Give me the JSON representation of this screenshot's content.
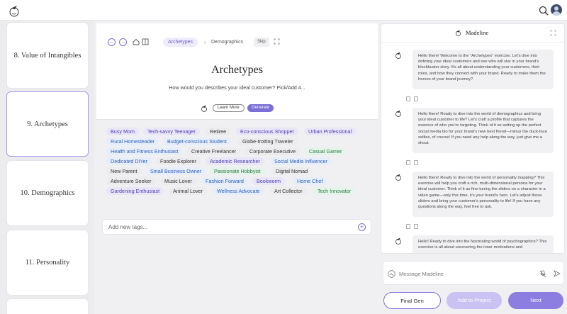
{
  "header": {
    "icons": [
      "wizard-logo-icon",
      "search-icon",
      "avatar"
    ]
  },
  "steps": [
    {
      "label": "8. Value of Intangibles"
    },
    {
      "label": "9. Archetypes"
    },
    {
      "label": "10. Demographics"
    },
    {
      "label": "11. Personality"
    }
  ],
  "breadcrumb": {
    "current": "Archetypes",
    "next": "Demographics",
    "skip": "Skip"
  },
  "main": {
    "title": "Archetypes",
    "question": "How would you describes your ideal customer? Pick/Add 4...",
    "learn_more": "Learn More",
    "generate": "Generate",
    "new_tag_placeholder": "Add new tags..."
  },
  "tags": [
    {
      "text": "Busy Mom",
      "color": "purple"
    },
    {
      "text": "Tech-savvy Teenager",
      "color": "purple"
    },
    {
      "text": "Retiree",
      "color": "gray"
    },
    {
      "text": "Eco-conscious Shopper",
      "color": "purple"
    },
    {
      "text": "Urban Professional",
      "color": "purple"
    },
    {
      "text": "Rural Homesteader",
      "color": "blue"
    },
    {
      "text": "Budget-conscious Student",
      "color": "blue"
    },
    {
      "text": "Globe-trotting Traveler",
      "color": "gray"
    },
    {
      "text": "Health and Fitness Enthusiast",
      "color": "blue"
    },
    {
      "text": "Creative Freelancer",
      "color": "gray"
    },
    {
      "text": "Corporate Executive",
      "color": "gray"
    },
    {
      "text": "Casual Gamer",
      "color": "green"
    },
    {
      "text": "Dedicated DIYer",
      "color": "blue"
    },
    {
      "text": "Foodie Explorer",
      "color": "gray"
    },
    {
      "text": "Academic Researcher",
      "color": "purple"
    },
    {
      "text": "Social Media Influencer",
      "color": "blue"
    },
    {
      "text": "New Parent",
      "color": "gray"
    },
    {
      "text": "Small Business Owner",
      "color": "blue"
    },
    {
      "text": "Passionate Hobbyist",
      "color": "green"
    },
    {
      "text": "Digital Nomad",
      "color": "gray"
    },
    {
      "text": "Adventure Seeker",
      "color": "gray"
    },
    {
      "text": "Music Lover",
      "color": "gray"
    },
    {
      "text": "Fashion Forward",
      "color": "blue"
    },
    {
      "text": "Bookworm",
      "color": "purple"
    },
    {
      "text": "Home Chef",
      "color": "blue"
    },
    {
      "text": "Gardening Enthusiast",
      "color": "purple"
    },
    {
      "text": "Animal Lover",
      "color": "gray"
    },
    {
      "text": "Wellness Advocate",
      "color": "blue"
    },
    {
      "text": "Art Collector",
      "color": "gray"
    },
    {
      "text": "Tech Innovator",
      "color": "green"
    }
  ],
  "chat": {
    "assistant_name": "Madeline",
    "input_placeholder": "Message Madeline",
    "messages": [
      {
        "text": "Hello there! Welcome to the \"Archetypes\" exercise. Let's dive into defining your ideal customers and see who will star in your brand's blockbuster story. It's all about understanding your customers, their roles, and how they connect with your brand. Ready to make them the heroes of your brand journey?"
      },
      {
        "text": "Hello there! Ready to dive into the world of demographics and bring your ideal customer to life? Let's craft a profile that captures the essence of who you're targeting. Think of it as setting up the perfect social media bio for your brand's new best friend—minus the duck-face selfies, of course! If you need any help along the way, just give me a shout."
      },
      {
        "text": "Hello there! Ready to dive into the world of personality mapping? This exercise will help you craft a rich, multi-dimensional persona for your ideal customer. Think of it as fine-tuning the sliders on a character in a video game—only this time, it's your brand's hero. Let's adjust those sliders and bring your customer's personality to life! If you have any questions along the way, feel free to ask."
      },
      {
        "text": "Hello! Ready to dive into the fascinating world of psychographics? This exercise is all about uncovering the inner motivations and"
      }
    ]
  },
  "footer": {
    "final_gen": "Final Gen",
    "add_to_project": "Add to Project",
    "next": "Next"
  },
  "colors": {
    "accent": "#7b6fd6",
    "accent_light": "#c9c2f2"
  }
}
